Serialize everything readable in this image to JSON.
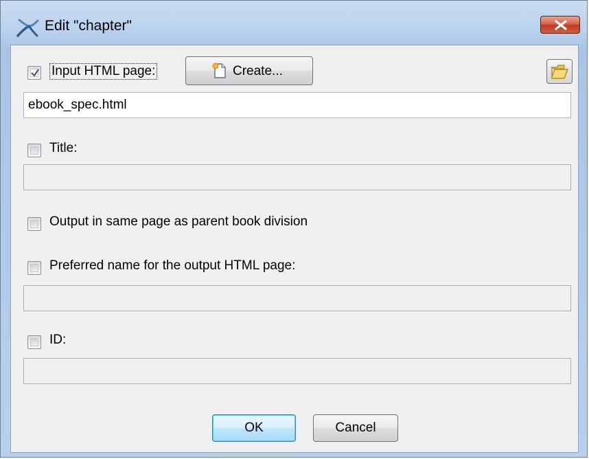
{
  "window": {
    "title": "Edit \"chapter\"",
    "app_icon": "xmlmind-icon",
    "close_icon": "close-icon"
  },
  "input_html": {
    "checkbox_checked": true,
    "label": "Input HTML page:",
    "create_label": "Create...",
    "create_icon": "new-page-icon",
    "browse_icon": "folder-open-icon",
    "value": "ebook_spec.html"
  },
  "title_field": {
    "checkbox_checked": false,
    "label": "Title:",
    "value": ""
  },
  "same_page": {
    "checkbox_checked": false,
    "label": "Output in same page as parent book division"
  },
  "preferred_name": {
    "checkbox_checked": false,
    "label": "Preferred name for the output HTML page:",
    "value": ""
  },
  "id_field": {
    "checkbox_checked": false,
    "label": "ID:",
    "value": ""
  },
  "buttons": {
    "ok": "OK",
    "cancel": "Cancel"
  },
  "colors": {
    "frame": "#b9d0ec",
    "close": "#c3391e",
    "dialog_bg": "#f0f0f0"
  }
}
